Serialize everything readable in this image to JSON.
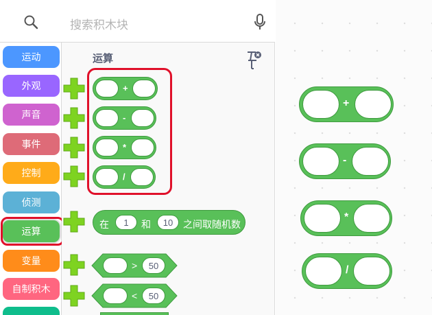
{
  "search": {
    "placeholder": "搜索积木块"
  },
  "categories": [
    {
      "label": "运动",
      "color": "#4c97ff"
    },
    {
      "label": "外观",
      "color": "#9966ff"
    },
    {
      "label": "声音",
      "color": "#cf63cf"
    },
    {
      "label": "事件",
      "color": "#de6b78"
    },
    {
      "label": "控制",
      "color": "#ffab19"
    },
    {
      "label": "侦测",
      "color": "#5cb1d6"
    },
    {
      "label": "运算",
      "color": "#59c059",
      "selected": true
    },
    {
      "label": "变量",
      "color": "#ff8c1a"
    },
    {
      "label": "自制积木",
      "color": "#ff6680"
    }
  ],
  "palette": {
    "section_title": "运算",
    "arith_blocks": [
      {
        "symbol": "+"
      },
      {
        "symbol": "-"
      },
      {
        "symbol": "*"
      },
      {
        "symbol": "/"
      }
    ],
    "random_block": {
      "prefix": "在",
      "from": "1",
      "middle": "和",
      "to": "10",
      "suffix": "之间取随机数"
    },
    "compare_blocks": [
      {
        "symbol": ">",
        "value": "50"
      },
      {
        "symbol": "<",
        "value": "50"
      }
    ]
  },
  "workspace": {
    "blocks": [
      {
        "symbol": "+"
      },
      {
        "symbol": "-"
      },
      {
        "symbol": "*"
      },
      {
        "symbol": "/"
      }
    ]
  },
  "colors": {
    "operators": "#59c059",
    "operators_border": "#3e9a3e",
    "highlight": "#e0102a",
    "plus_icon": "#7ed321"
  }
}
